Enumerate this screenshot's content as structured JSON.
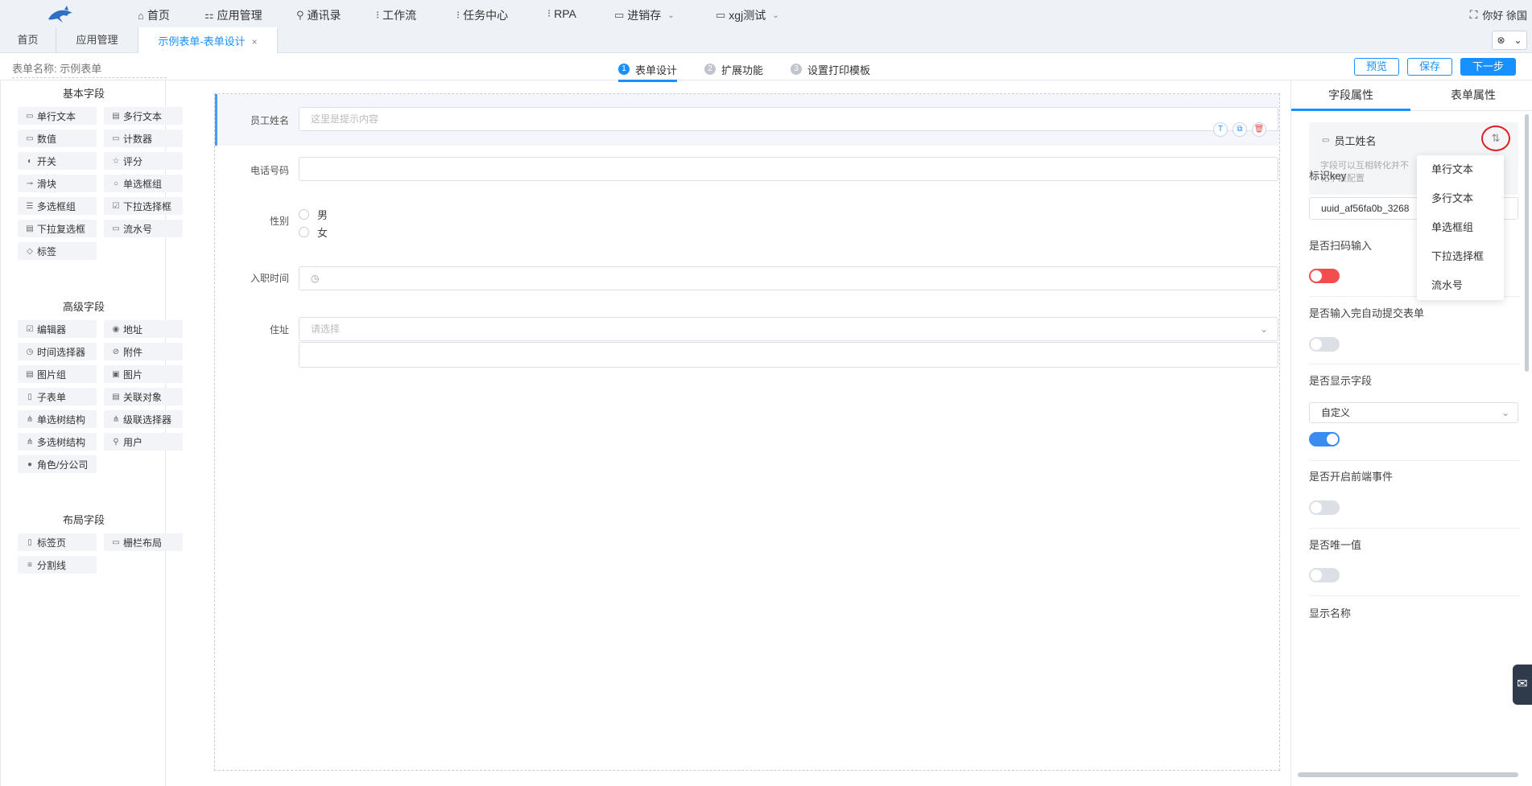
{
  "nav": {
    "items": [
      {
        "label": "首页",
        "icon": "home-icon"
      },
      {
        "label": "应用管理",
        "icon": "apps-icon"
      },
      {
        "label": "通讯录",
        "icon": "user-icon"
      },
      {
        "label": "工作流",
        "icon": "workflow-icon"
      },
      {
        "label": "任务中心",
        "icon": "workflow-icon"
      },
      {
        "label": "RPA",
        "icon": "workflow-icon"
      },
      {
        "label": "进销存",
        "icon": "folder-icon"
      },
      {
        "label": "xgj测试",
        "icon": "folder-icon"
      }
    ],
    "greeting": "你好 徐国"
  },
  "tabs": [
    {
      "label": "首页"
    },
    {
      "label": "应用管理"
    },
    {
      "label": "示例表单-表单设计",
      "active": true
    }
  ],
  "formbar": {
    "name_label": "表单名称:",
    "name_value": "示例表单",
    "steps": [
      {
        "num": "1",
        "label": "表单设计",
        "active": true
      },
      {
        "num": "2",
        "label": "扩展功能"
      },
      {
        "num": "3",
        "label": "设置打印模板"
      }
    ],
    "buttons": {
      "preview": "预览",
      "save": "保存",
      "next": "下一步"
    }
  },
  "palette": {
    "basic_title": "基本字段",
    "basic": [
      "单行文本",
      "多行文本",
      "数值",
      "计数器",
      "开关",
      "评分",
      "滑块",
      "单选框组",
      "多选框组",
      "下拉选择框",
      "下拉复选框",
      "流水号",
      "标签"
    ],
    "advanced_title": "高级字段",
    "advanced": [
      "编辑器",
      "地址",
      "时间选择器",
      "附件",
      "图片组",
      "图片",
      "子表单",
      "关联对象",
      "单选树结构",
      "级联选择器",
      "多选树结构",
      "用户",
      "角色/分公司"
    ],
    "layout_title": "布局字段",
    "layout": [
      "标签页",
      "栅栏布局",
      "分割线"
    ]
  },
  "canvas": {
    "fields": {
      "name_label": "员工姓名",
      "name_placeholder": "这里是提示内容",
      "phone_label": "电话号码",
      "gender_label": "性别",
      "gender_options": [
        "男",
        "女"
      ],
      "hire_label": "入职时间",
      "address_label": "住址",
      "address_placeholder": "请选择"
    }
  },
  "props": {
    "tabs": [
      "字段属性",
      "表单属性"
    ],
    "card_title": "员工姓名",
    "card_hint": "字段可以互相转化并不化字段配置",
    "key_label": "标识key",
    "key_value": "uuid_af56fa0b_3268",
    "scan_label": "是否扫码输入",
    "autosubmit_label": "是否输入完自动提交表单",
    "show_label": "是否显示字段",
    "show_select": "自定义",
    "frontend_label": "是否开启前端事件",
    "unique_label": "是否唯一值",
    "display_name_label": "显示名称",
    "convert_menu": [
      "单行文本",
      "多行文本",
      "单选框组",
      "下拉选择框",
      "流水号"
    ]
  },
  "colors": {
    "accent": "#1890ff",
    "danger": "#f34d4d"
  }
}
